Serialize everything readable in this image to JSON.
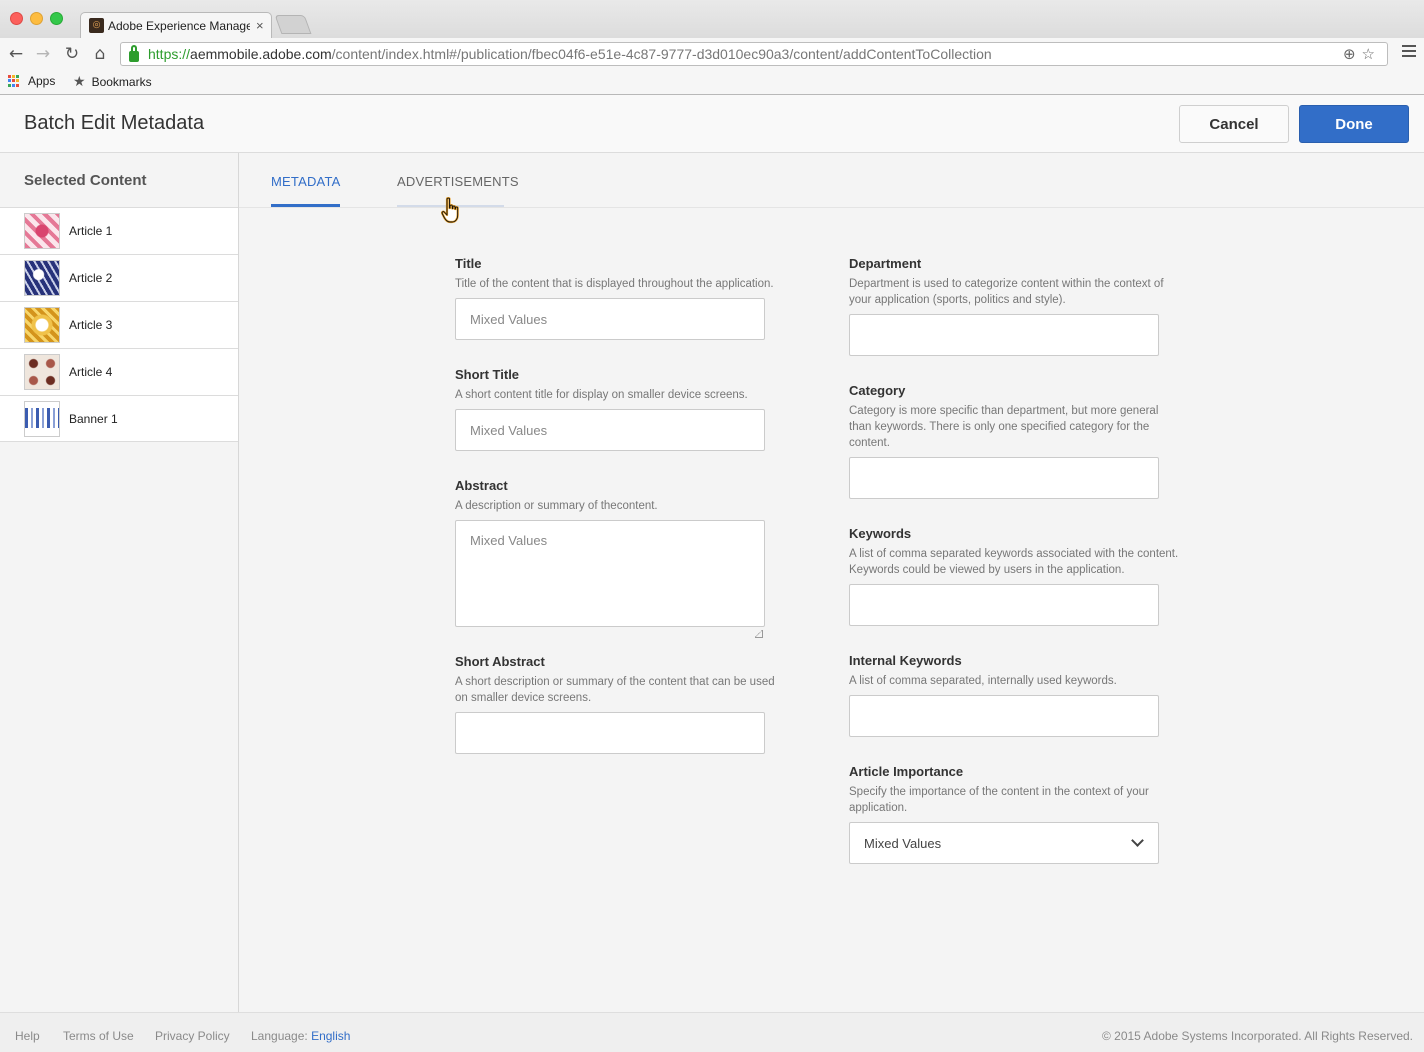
{
  "browser": {
    "tab_title": "Adobe Experience Manager",
    "tab_close": "×",
    "url_scheme": "https://",
    "url_host": "aemmobile.adobe.com",
    "url_path": "/content/index.html#/publication/fbec04f6-e51e-4c87-9777-d3d010ec90a3/content/addContentToCollection",
    "bookmarks": [
      {
        "label": "Apps",
        "icon": "apps-grid-icon"
      },
      {
        "label": "Bookmarks",
        "icon": "star-icon"
      }
    ]
  },
  "header": {
    "title": "Batch Edit Metadata",
    "cancel_label": "Cancel",
    "done_label": "Done",
    "accent_color": "#326ec8"
  },
  "sidebar": {
    "heading": "Selected Content",
    "items": [
      {
        "label": "Article 1",
        "thumb": "pink-pattern"
      },
      {
        "label": "Article 2",
        "thumb": "navy-pattern"
      },
      {
        "label": "Article 3",
        "thumb": "yellow-pattern"
      },
      {
        "label": "Article 4",
        "thumb": "brown-pattern"
      },
      {
        "label": "Banner 1",
        "thumb": "blue-stripes"
      }
    ]
  },
  "tabs": [
    {
      "label": "METADATA",
      "active": true
    },
    {
      "label": "ADVERTISEMENTS",
      "active": false
    }
  ],
  "form": {
    "title": {
      "label": "Title",
      "help": "Title of the content that is displayed throughout the application.",
      "placeholder": "Mixed Values"
    },
    "short_title": {
      "label": "Short Title",
      "help": "A short content title for display on smaller device screens.",
      "placeholder": "Mixed Values"
    },
    "abstract": {
      "label": "Abstract",
      "help": "A description or summary of thecontent.",
      "placeholder": "Mixed Values"
    },
    "short_abstract": {
      "label": "Short Abstract",
      "help": "A short description or summary of the content that can be used on smaller device screens.",
      "placeholder": ""
    },
    "department": {
      "label": "Department",
      "help": "Department is used to categorize content within the context of your application (sports, politics and style).",
      "placeholder": ""
    },
    "category": {
      "label": "Category",
      "help": "Category is more specific than department, but more general than keywords. There is only one specified category for the content.",
      "placeholder": ""
    },
    "keywords": {
      "label": "Keywords",
      "help": "A list of comma separated keywords associated with the content. Keywords could be viewed by users in the application.",
      "placeholder": ""
    },
    "internal_keywords": {
      "label": "Internal Keywords",
      "help": "A list of comma separated, internally used keywords.",
      "placeholder": ""
    },
    "article_importance": {
      "label": "Article Importance",
      "help": "Specify the importance of the content in the context of your application.",
      "value": "Mixed Values"
    }
  },
  "footer": {
    "help": "Help",
    "terms": "Terms of Use",
    "privacy": "Privacy Policy",
    "language_label": "Language:",
    "language_value": "English",
    "copyright": "© 2015 Adobe Systems Incorporated. All Rights Reserved."
  }
}
